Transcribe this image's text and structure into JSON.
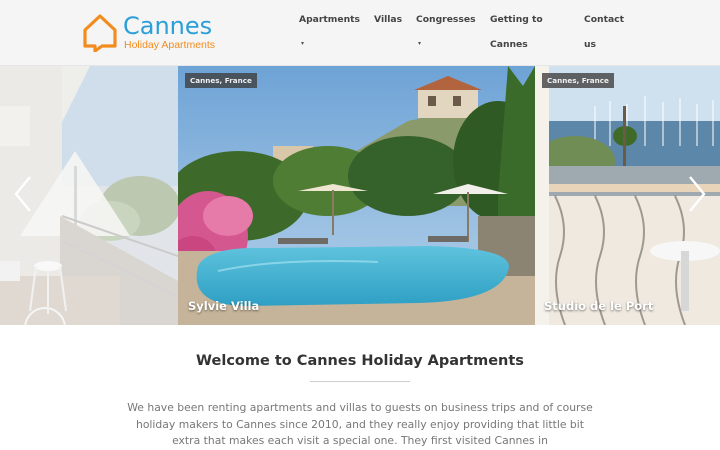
{
  "brand": {
    "name": "Cannes",
    "tagline": "Holiday Apartments",
    "primary_color": "#2a9fd8",
    "accent_color": "#f28c1e"
  },
  "nav": {
    "items": [
      {
        "label": "Apartments",
        "has_dropdown": true
      },
      {
        "label": "Villas",
        "has_dropdown": false
      },
      {
        "label": "Congresses",
        "has_dropdown": true
      },
      {
        "label_line1": "Getting to",
        "label_line2": "Cannes",
        "has_dropdown": false
      },
      {
        "label": "Contact",
        "label_line2": "us",
        "has_dropdown": false
      }
    ],
    "dropdown_icon": "caret-down-icon"
  },
  "slider": {
    "slides": [
      {
        "location": "",
        "title": "",
        "description": "balcony with white chairs and umbrella"
      },
      {
        "location": "Cannes, France",
        "title": "Sylvie Villa"
      },
      {
        "location": "Cannes, France",
        "title": "Studio de le Port"
      }
    ],
    "prev_icon": "chevron-left-icon",
    "next_icon": "chevron-right-icon"
  },
  "welcome": {
    "title": "Welcome to Cannes Holiday Apartments",
    "text": "We have been renting apartments and villas to guests on business trips and of course holiday makers to Cannes since 2010, and they really enjoy providing that little bit extra that makes each visit a special one. They first visited Cannes in"
  }
}
